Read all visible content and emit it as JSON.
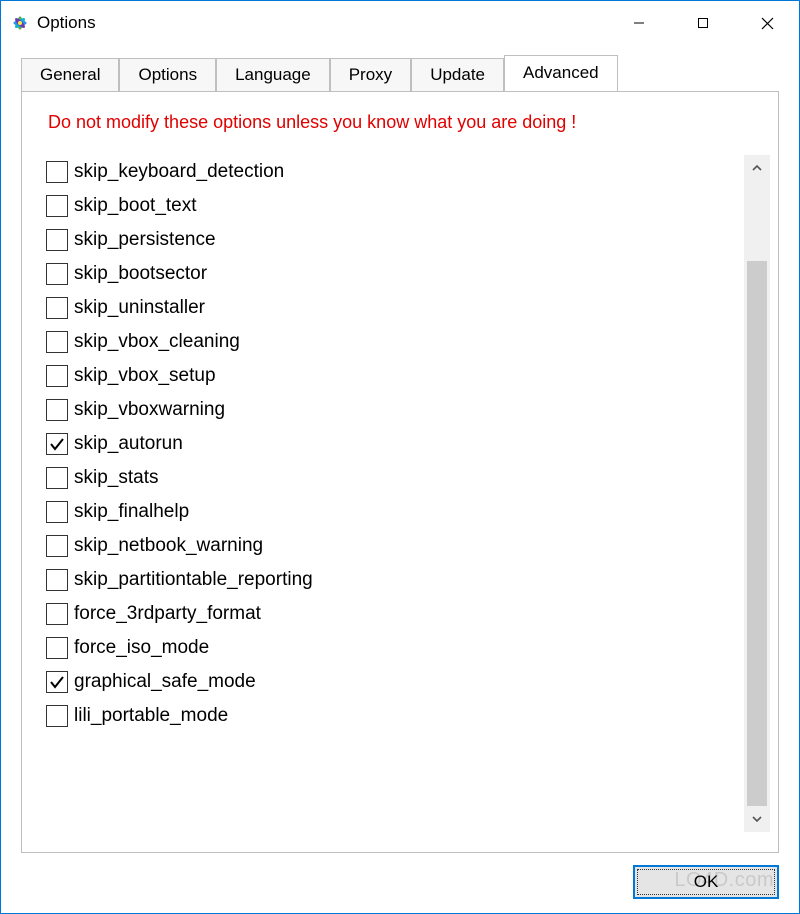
{
  "window": {
    "title": "Options"
  },
  "tabs": [
    {
      "label": "General"
    },
    {
      "label": "Options"
    },
    {
      "label": "Language"
    },
    {
      "label": "Proxy"
    },
    {
      "label": "Update"
    },
    {
      "label": "Advanced"
    }
  ],
  "active_tab_index": 5,
  "advanced": {
    "warning": "Do not modify these options unless you know what you are doing !",
    "options": [
      {
        "label": "skip_keyboard_detection",
        "checked": false
      },
      {
        "label": "skip_boot_text",
        "checked": false
      },
      {
        "label": "skip_persistence",
        "checked": false
      },
      {
        "label": "skip_bootsector",
        "checked": false
      },
      {
        "label": "skip_uninstaller",
        "checked": false
      },
      {
        "label": "skip_vbox_cleaning",
        "checked": false
      },
      {
        "label": "skip_vbox_setup",
        "checked": false
      },
      {
        "label": "skip_vboxwarning",
        "checked": false
      },
      {
        "label": "skip_autorun",
        "checked": true
      },
      {
        "label": "skip_stats",
        "checked": false
      },
      {
        "label": "skip_finalhelp",
        "checked": false
      },
      {
        "label": "skip_netbook_warning",
        "checked": false
      },
      {
        "label": "skip_partitiontable_reporting",
        "checked": false
      },
      {
        "label": "force_3rdparty_format",
        "checked": false
      },
      {
        "label": "force_iso_mode",
        "checked": false
      },
      {
        "label": "graphical_safe_mode",
        "checked": true
      },
      {
        "label": "lili_portable_mode",
        "checked": false
      }
    ]
  },
  "buttons": {
    "ok": "OK"
  },
  "watermark": "LO4D.com"
}
